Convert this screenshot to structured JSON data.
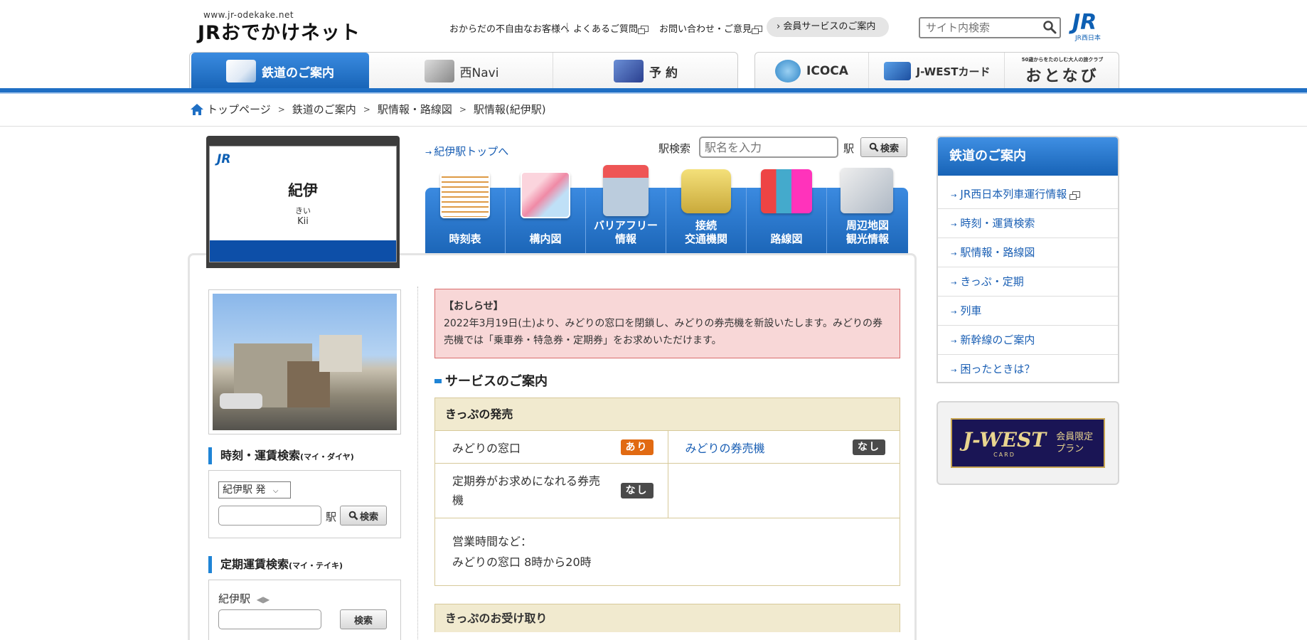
{
  "header": {
    "logo_small": "www.jr-odekake.net",
    "logo_main": "JRおでかけネット",
    "links": [
      {
        "label": "おからだの不自由なお客様へ"
      },
      {
        "label": "よくあるご質問"
      },
      {
        "label": "お問い合わせ・ご意見"
      }
    ],
    "member_label": "› 会員サービスのご案内",
    "search_placeholder": "サイト内検索",
    "jr_logo": "JR",
    "jr_logo_sub": "JR西日本"
  },
  "nav": {
    "tabs": [
      {
        "label": "鉄道のご案内",
        "active": true
      },
      {
        "label": "西Navi"
      },
      {
        "label": "予 約"
      },
      {
        "label": "ICOCA"
      },
      {
        "label": "J-WESTカード"
      },
      {
        "label": "おとなび",
        "tagline": "50歳からをたのしむ大人の旅クラブ"
      }
    ]
  },
  "breadcrumb": [
    {
      "label": "トップページ",
      "link": true
    },
    {
      "label": "鉄道のご案内",
      "link": true
    },
    {
      "label": "駅情報・路線図",
      "link": true
    },
    {
      "label": "駅情報(紀伊駅)",
      "link": false
    }
  ],
  "station": {
    "sign_logo": "JR",
    "name": "紀伊",
    "kana": "きい",
    "roman": "Kii",
    "top_link": "紀伊駅トップへ",
    "search_label": "駅検索",
    "search_placeholder": "駅名を入力",
    "eki_suffix": "駅",
    "search_button": "検索"
  },
  "station_menu": [
    {
      "label": "時刻表"
    },
    {
      "label": "構内図"
    },
    {
      "label": "バリアフリー\n情報"
    },
    {
      "label": "接続\n交通機関"
    },
    {
      "label": "路線図"
    },
    {
      "label": "周辺地図\n観光情報"
    }
  ],
  "left": {
    "timetable_heading": "時刻・運賃検索",
    "timetable_sub": "(マイ・ダイヤ)",
    "dep_select": "紀伊駅 発",
    "eki_suffix": "駅",
    "search_button": "検索",
    "commuter_heading": "定期運賃検索",
    "commuter_sub": "(マイ・テイキ)",
    "commuter_station": "紀伊駅"
  },
  "notice": {
    "title": "【おしらせ】",
    "body": "2022年3月19日(土)より、みどりの窓口を閉鎖し、みどりの券売機を新設いたします。みどりの券売機では「乗車券・特急券・定期券」をお求めいただけます。"
  },
  "services": {
    "heading": "サービスのご案内",
    "table_head": "きっぷの発売",
    "rows": [
      [
        {
          "label": "みどりの窓口",
          "badge": "あり",
          "status": "yes"
        },
        {
          "label": "みどりの券売機",
          "badge": "なし",
          "status": "no",
          "link": true
        }
      ],
      [
        {
          "label": "定期券がお求めになれる券売機",
          "badge": "なし",
          "status": "no"
        },
        {
          "label": ""
        }
      ]
    ],
    "hours_label": "営業時間など：",
    "hours_value": "みどりの窓口 8時から20時",
    "next_head": "きっぷのお受け取り"
  },
  "sidebar": {
    "title": "鉄道のご案内",
    "items": [
      {
        "label": "JR西日本列車運行情報",
        "external": true
      },
      {
        "label": "時刻・運賃検索"
      },
      {
        "label": "駅情報・路線図"
      },
      {
        "label": "きっぷ・定期"
      },
      {
        "label": "列車"
      },
      {
        "label": "新幹線のご案内"
      },
      {
        "label": "困ったときは？"
      }
    ],
    "banner_big": "J-WEST",
    "banner_card": "CARD",
    "banner_small": "会員限定\nプラン"
  },
  "colors": {
    "brand_blue": "#1f6fc4",
    "notice_bg": "#f8d7d7",
    "badge_yes": "#e16a12",
    "badge_no": "#4a4a4a"
  }
}
